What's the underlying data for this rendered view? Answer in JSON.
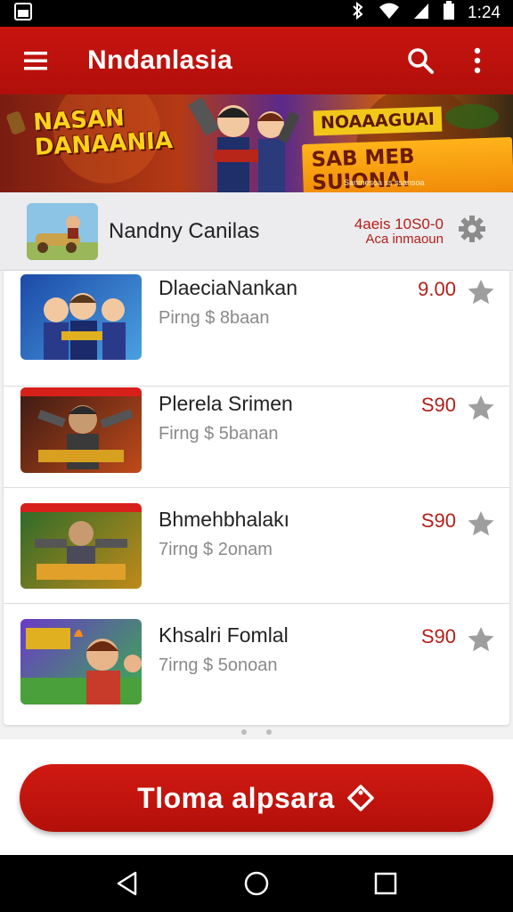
{
  "status_bar": {
    "time": "1:24",
    "icons": [
      "image-icon",
      "bluetooth-icon",
      "wifi-icon",
      "signal-icon",
      "battery-icon"
    ]
  },
  "app_bar": {
    "title": "Nndanlasia",
    "menu_icon": "menu-icon",
    "search_icon": "search-icon",
    "more_icon": "more-vert-icon",
    "color": "#c8140f"
  },
  "banner": {
    "left_title": "NASAN DANAANIA",
    "tag_top": "NOAAAGUAI",
    "tag_main": "SAB MEB SUIONA!",
    "small_text": "Sanmesoa ss ssansoa"
  },
  "sub_header": {
    "title": "Nandny Canilas",
    "meta_line1": "4aeis 10S0-0",
    "meta_line2": "Aca inmaoun",
    "settings_icon": "gear-icon"
  },
  "items": [
    {
      "name": "DlaeciaNankan",
      "subtitle": "Pirng $ 8baan",
      "price": "9.00"
    },
    {
      "name": "Plerela Srimen",
      "subtitle": "Firng $ 5banan",
      "price": "S90"
    },
    {
      "name": "Bhmehbhalakı",
      "subtitle": "7irng $ 2onam",
      "price": "S90"
    },
    {
      "name": "Khsalri Fomlal",
      "subtitle": "7irng $ 5onoan",
      "price": "S90"
    }
  ],
  "cta": {
    "label": "Tloma alpsara",
    "icon": "tag-icon"
  },
  "nav": {
    "back_icon": "back-icon",
    "home_icon": "home-icon",
    "recents_icon": "recents-icon"
  },
  "colors": {
    "brand_red": "#c8140f",
    "price_red": "#b3201a",
    "star_gray": "#9e9e9e"
  }
}
